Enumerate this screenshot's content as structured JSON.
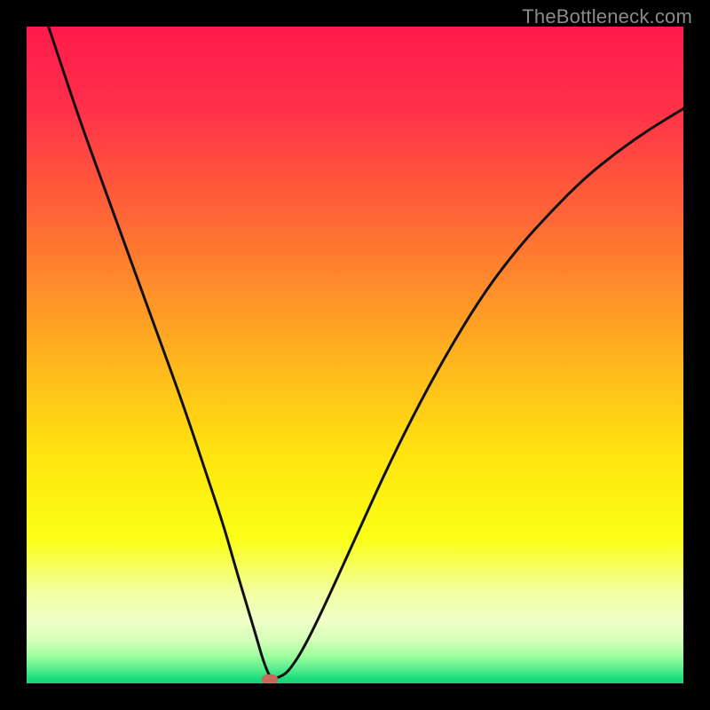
{
  "watermark": "TheBottleneck.com",
  "colors": {
    "bg": "#000000",
    "marker": "#c66a5c",
    "curve": "#111111",
    "gradient_stops": [
      {
        "offset": 0.0,
        "color": "#ff1a4d"
      },
      {
        "offset": 0.12,
        "color": "#ff2f49"
      },
      {
        "offset": 0.3,
        "color": "#ff6a35"
      },
      {
        "offset": 0.5,
        "color": "#ffb21f"
      },
      {
        "offset": 0.65,
        "color": "#ffe40f"
      },
      {
        "offset": 0.78,
        "color": "#fbff16"
      },
      {
        "offset": 0.86,
        "color": "#f2ffa0"
      },
      {
        "offset": 0.905,
        "color": "#efffc8"
      },
      {
        "offset": 0.935,
        "color": "#d4ffb8"
      },
      {
        "offset": 0.958,
        "color": "#9fff9f"
      },
      {
        "offset": 0.976,
        "color": "#5fef90"
      },
      {
        "offset": 0.992,
        "color": "#1edc7d"
      },
      {
        "offset": 1.0,
        "color": "#17d276"
      }
    ]
  },
  "chart_data": {
    "type": "line",
    "title": "",
    "xlabel": "",
    "ylabel": "",
    "xlim": [
      0,
      100
    ],
    "ylim": [
      0,
      100
    ],
    "minimum_marker": {
      "x": 37,
      "y": 0.5
    },
    "series": [
      {
        "name": "bottleneck-curve",
        "x": [
          0,
          4,
          8,
          12,
          16,
          20,
          24,
          28,
          30,
          32,
          33.5,
          35,
          36,
          37,
          37.5,
          38,
          39,
          40,
          42,
          45,
          50,
          55,
          60,
          65,
          70,
          75,
          80,
          85,
          90,
          95,
          100
        ],
        "y": [
          110,
          98,
          86,
          75,
          64,
          53,
          42,
          30,
          24,
          17,
          12,
          7,
          3.5,
          1,
          0.8,
          0.8,
          1.2,
          2,
          5,
          11,
          22,
          33,
          43,
          52,
          60,
          66.5,
          72,
          77,
          81,
          84.5,
          87.5
        ]
      }
    ]
  }
}
